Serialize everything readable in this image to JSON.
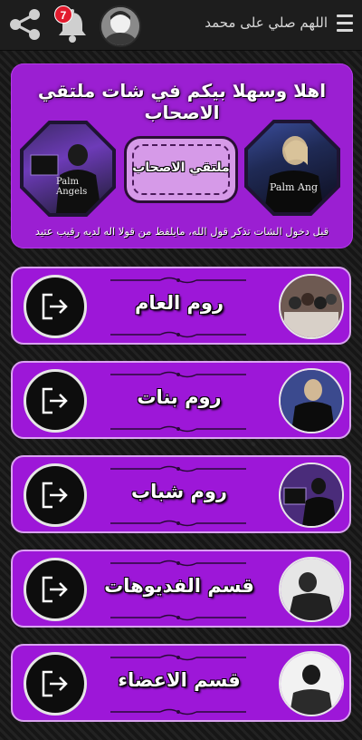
{
  "header": {
    "title": "اللهم صلي على محمد",
    "notification_count": "7"
  },
  "banner": {
    "title": "اهلا وسهلا بيكم في شات ملتقي الاصحاب",
    "logo_text": "ملتقي الاصحاب",
    "subtitle": "قبل دخول الشات تذكر قول الله، مايلفظ من قولا اله لديه رقيب عتيد",
    "left_photo_text": "Palm Angels",
    "right_photo_text": "Palm Ang"
  },
  "rooms": [
    {
      "label": "روم العام",
      "avatar": "group-photo",
      "exit_icon": "exit-icon"
    },
    {
      "label": "روم بنات",
      "avatar": "girl-photo",
      "exit_icon": "exit-icon"
    },
    {
      "label": "روم شباب",
      "avatar": "boy-photo",
      "exit_icon": "exit-icon"
    },
    {
      "label": "قسم الفديوهات",
      "avatar": "video-photo",
      "exit_icon": "exit-icon"
    },
    {
      "label": "قسم الاعضاء",
      "avatar": "member-photo",
      "exit_icon": "exit-icon"
    }
  ],
  "colors": {
    "accent": "#9d17d8",
    "badge": "#e21b2e",
    "background": "#181818"
  }
}
